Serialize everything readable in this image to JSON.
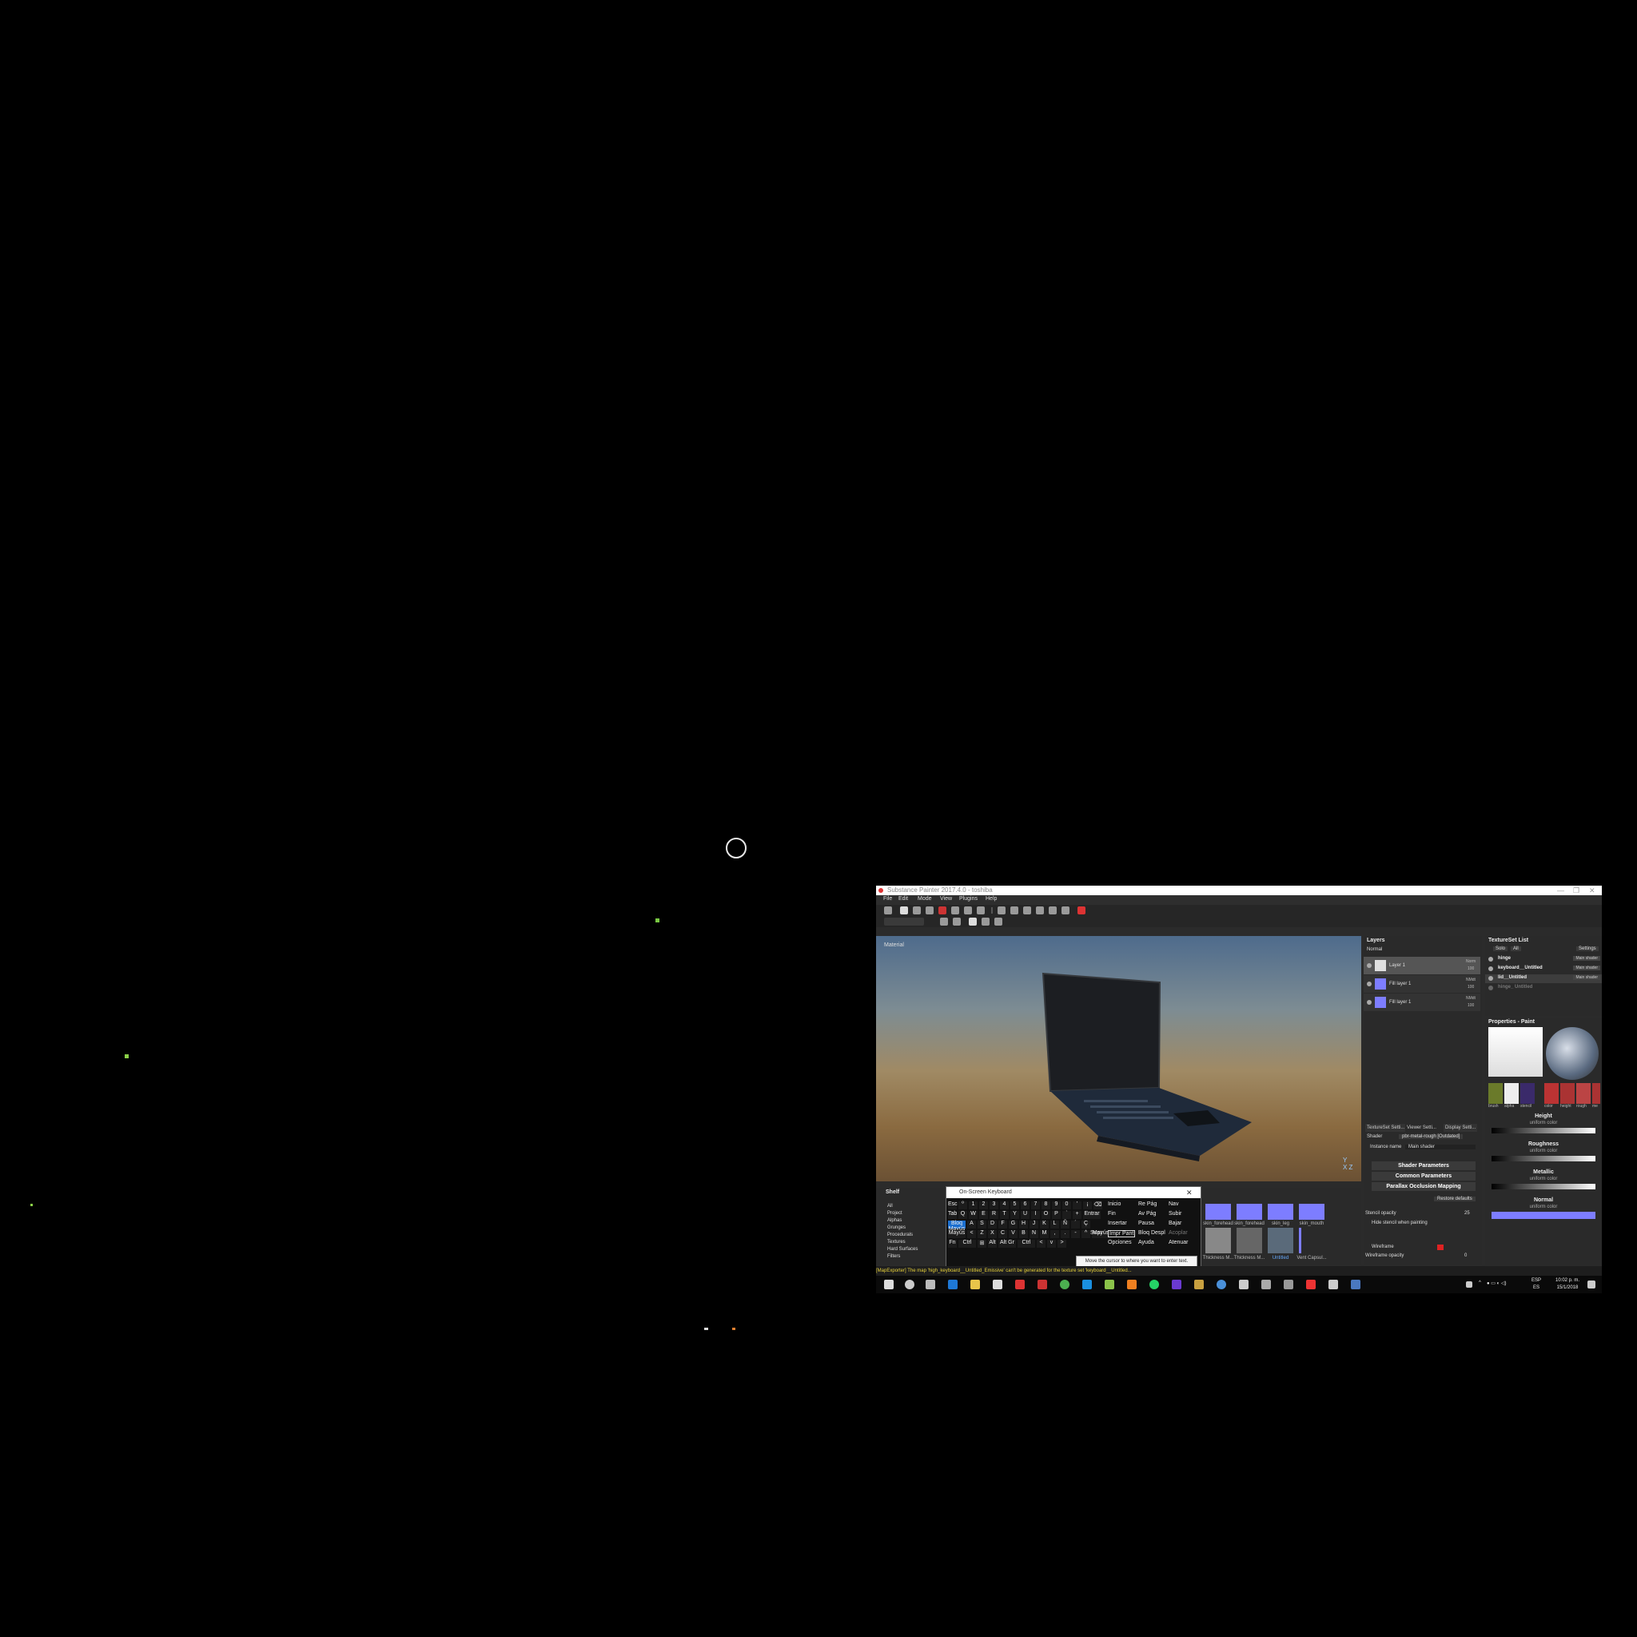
{
  "window": {
    "title": "Substance Painter 2017.4.0 - toshiba",
    "controls": [
      "—",
      "❐",
      "✕"
    ]
  },
  "menu": [
    "File",
    "Edit",
    "Mode",
    "View",
    "Plugins",
    "Help"
  ],
  "viewport": {
    "label": "Material",
    "axis": "Y\n  X Z"
  },
  "shelf": {
    "title": "Shelf",
    "categories": [
      "All",
      "Project",
      "Alphas",
      "Grunges",
      "Procedurals",
      "Textures",
      "Hard Surfaces",
      "Filters"
    ],
    "top_items": [
      "skin_forehead",
      "skin_forehead",
      "skin_leg",
      "skin_mouth"
    ],
    "bottom_items": [
      "Thickness M...",
      "Thickness M...",
      "Untitled",
      "Vent Capsul..."
    ]
  },
  "osk": {
    "title": "On-Screen Keyboard",
    "rows": [
      [
        "Esc",
        "º",
        "1",
        "2",
        "3",
        "4",
        "5",
        "6",
        "7",
        "8",
        "9",
        "0",
        "'",
        "¡",
        "⌫"
      ],
      [
        "Tab",
        "Q",
        "W",
        "E",
        "R",
        "T",
        "Y",
        "U",
        "I",
        "O",
        "P",
        "`",
        "+",
        "Entrar"
      ],
      [
        "Bloq Mayús",
        "A",
        "S",
        "D",
        "F",
        "G",
        "H",
        "J",
        "K",
        "L",
        "Ñ",
        "´",
        "Ç"
      ],
      [
        "Mayús",
        "<",
        "Z",
        "X",
        "C",
        "V",
        "B",
        "N",
        "M",
        ",",
        ".",
        "-",
        "^",
        "Mayús"
      ],
      [
        "Fn",
        "Ctrl",
        "⊞",
        "Alt",
        "Alt Gr",
        "Ctrl",
        "<",
        "v",
        ">"
      ]
    ],
    "nav": [
      [
        "Inicio",
        "Re Pág",
        "Nav"
      ],
      [
        "Fin",
        "Av Pág",
        "Subir"
      ],
      [
        "Insertar",
        "Pausa",
        "Bajar"
      ],
      [
        "Impr Pant",
        "Bloq Despl",
        "Acoplar"
      ],
      [
        "Opciones",
        "Ayuda",
        "Atenuar"
      ]
    ],
    "supr": "Supr",
    "tooltip": "Move the cursor to where you want to enter text."
  },
  "layers": {
    "title": "Layers",
    "blend": "Normal",
    "items": [
      {
        "name": "Layer 1",
        "blend": "Norm",
        "opacity": "100",
        "thumb": "#e0e0e0"
      },
      {
        "name": "Fill layer 1",
        "blend": "NMdt",
        "opacity": "100",
        "thumb": "#7d7dff"
      },
      {
        "name": "Fill layer 1",
        "blend": "NMdt",
        "opacity": "100",
        "thumb": "#7d7dff"
      }
    ]
  },
  "texture_sets": {
    "title": "TextureSet List",
    "solo": "Solo",
    "all": "All",
    "settings": "Settings",
    "items": [
      {
        "name": "hinge",
        "shader": "Main shader"
      },
      {
        "name": "keyboard__Untitled",
        "shader": "Main shader"
      },
      {
        "name": "lid__Untitled",
        "shader": "Main shader"
      },
      {
        "name": "hinge_ Untitled",
        "shader": ""
      }
    ]
  },
  "properties": {
    "title": "Properties - Paint",
    "channels_top": [
      "brush",
      "alpha",
      "stencil"
    ],
    "channels_right": [
      "color",
      "height",
      "rough",
      "me"
    ],
    "params": [
      {
        "name": "Height",
        "sub": "uniform color"
      },
      {
        "name": "Roughness",
        "sub": "uniform color"
      },
      {
        "name": "Metallic",
        "sub": "uniform color"
      },
      {
        "name": "Normal",
        "sub": "uniform color"
      }
    ]
  },
  "viewer_settings": {
    "tabs": [
      "TextureSet Setti...",
      "Viewer Setti...",
      "Display Setti..."
    ],
    "shader_label": "Shader",
    "shader_value": "pbr-metal-rough [Outdated]",
    "instance_label": "Instance name",
    "instance_value": "Main shader",
    "sections": [
      "Shader Parameters",
      "Common Parameters",
      "Parallax Occlusion Mapping"
    ],
    "restore": "Restore defaults",
    "stencil_opacity_label": "Stencil opacity",
    "stencil_opacity_value": "25",
    "hide_stencil": "Hide stencil when painting",
    "wireframe": "Wireframe",
    "wireframe_opacity_label": "Wireframe opacity",
    "wireframe_opacity_value": "0"
  },
  "status": "[MapExporter] The map 'high_keyboard__Untitled_Emissive' can't be generated for the texture set 'keyboard__Untitled...",
  "taskbar": {
    "lang1": "ESP",
    "lang2": "ES",
    "time": "10:02 p. m.",
    "date": "15/1/2018"
  }
}
